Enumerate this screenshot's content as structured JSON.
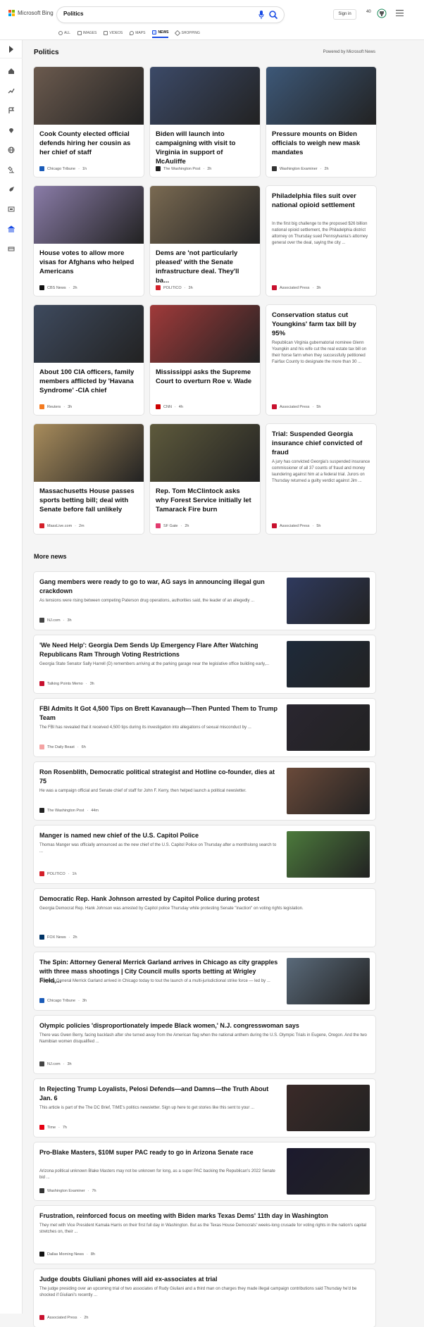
{
  "header": {
    "logo": "Microsoft Bing",
    "query": "Politics",
    "signin": "Sign in",
    "rewards": "40",
    "tabs": [
      {
        "label": "ALL",
        "icon": "search-icon"
      },
      {
        "label": "IMAGES",
        "icon": "image-icon"
      },
      {
        "label": "VIDEOS",
        "icon": "video-icon"
      },
      {
        "label": "MAPS",
        "icon": "map-pin-icon"
      },
      {
        "label": "NEWS",
        "icon": "news-icon",
        "active": true
      },
      {
        "label": "SHOPPING",
        "icon": "tag-icon"
      }
    ]
  },
  "section": {
    "title": "Politics",
    "powered": "Powered by Microsoft News"
  },
  "cards": [
    {
      "title": "Cook County elected official defends hiring her cousin as her chief of staff",
      "source": "Chicago Tribune",
      "time": "1h",
      "img": "#6b5a4e",
      "fav": "#1a5bb8"
    },
    {
      "title": "Biden will launch into campaigning with visit to Virginia in support of McAuliffe",
      "source": "The Washington Post",
      "time": "2h",
      "img": "#3c4a68",
      "fav": "#222"
    },
    {
      "title": "Pressure mounts on Biden officials to weigh new mask mandates",
      "source": "Washington Examiner",
      "time": "2h",
      "img": "#3d5878",
      "fav": "#333"
    },
    {
      "title": "House votes to allow more visas for Afghans who helped Americans",
      "source": "CBS News",
      "time": "2h",
      "img": "#8a7ca8",
      "fav": "#111"
    },
    {
      "title": "Dems are 'not particularly pleased' with the Senate infrastructure deal. They'll ba...",
      "source": "POLITICO",
      "time": "3h",
      "img": "#7a6a52",
      "fav": "#d4202a"
    },
    {
      "title": "Philadelphia files suit over national opioid settlement",
      "source": "Associated Press",
      "time": "3h",
      "snippet": "In the first big challenge to the proposed $26 billion national opioid settlement, the Philadelphia district attorney on Thursday sued Pennsylvania's attorney general over the deal, saying the city ...",
      "fav": "#c8102e"
    },
    {
      "title": "About 100 CIA officers, family members afflicted by 'Havana Syndrome' -CIA chief",
      "source": "Reuters",
      "time": "3h",
      "img": "#3e4a5e",
      "fav": "#f47b20"
    },
    {
      "title": "Mississippi asks the Supreme Court to overturn Roe v. Wade",
      "source": "CNN",
      "time": "4h",
      "img": "#a03a3a",
      "fav": "#cc0000"
    },
    {
      "title": "Conservation status cut Youngkins' farm tax bill by 95%",
      "source": "Associated Press",
      "time": "5h",
      "snippet": "Republican Virginia gubernatorial nominee Glenn Youngkin and his wife cut the real estate tax bill on their horse farm when they successfully petitioned Fairfax County to designate the more than 30 ...",
      "fav": "#c8102e"
    },
    {
      "title": "Massachusetts House passes sports betting bill; deal with Senate before fall unlikely",
      "source": "MassLive.com",
      "time": "2m",
      "img": "#a88c5c",
      "fav": "#d4202a"
    },
    {
      "title": "Rep. Tom McClintock asks why Forest Service initially let Tamarack Fire burn",
      "source": "SF Gate",
      "time": "2h",
      "img": "#5e5a3c",
      "fav": "#e23b6e"
    },
    {
      "title": "Trial: Suspended Georgia insurance chief convicted of fraud",
      "source": "Associated Press",
      "time": "5h",
      "snippet": "A jury has convicted Georgia's suspended insurance commissioner of all 37 counts of fraud and money laundering against him at a federal trial. Jurors on Thursday returned a guilty verdict against Jim ...",
      "fav": "#c8102e"
    }
  ],
  "more": {
    "title": "More news",
    "items": [
      {
        "title": "Gang members were ready to go to war, AG says in announcing illegal gun crackdown",
        "snippet": "As tensions were rising between competing Paterson drug operations, authorities said, the leader of an allegedly ...",
        "source": "NJ.com",
        "time": "3h",
        "img": "#2f3a5e",
        "fav": "#444"
      },
      {
        "title": "'We Need Help': Georgia Dem Sends Up Emergency Flare After Watching Republicans Ram Through Voting Restrictions",
        "snippet": "Georgia State Senator Sally Harrell (D) remembers arriving at the parking garage near the legislative office building early,...",
        "source": "Talking Points Memo",
        "time": "3h",
        "img": "#1e2a3a",
        "fav": "#c8102e"
      },
      {
        "title": "FBI Admits It Got 4,500 Tips on Brett Kavanaugh—Then Punted Them to Trump Team",
        "snippet": "The FBI has revealed that it received 4,500 tips during its investigation into allegations of sexual misconduct by ...",
        "source": "The Daily Beast",
        "time": "6h",
        "img": "#2a2630",
        "fav": "#f4a3a3"
      },
      {
        "title": "Ron Rosenblith, Democratic political strategist and Hotline co-founder, dies at 75",
        "snippet": "He was a campaign official and Senate chief of staff for John F. Kerry, then helped launch a political newsletter.",
        "source": "The Washington Post",
        "time": "44m",
        "img": "#6a4a3a",
        "fav": "#222"
      },
      {
        "title": "Manger is named new chief of the U.S. Capitol Police",
        "snippet": "Thomas Manger was officially announced as the new chief of the U.S. Capitol Police on Thursday after a monthslong search to ...",
        "source": "POLITICO",
        "time": "1h",
        "img": "#4c7a3c",
        "fav": "#d4202a"
      },
      {
        "title": "Democratic Rep. Hank Johnson arrested by Capitol Police during protest",
        "snippet": "Georgia Democrat Rep. Hank Johnson was arrested by Capitol police Thursday while protesting Senate \"inaction\" on voting rights legislation.",
        "source": "FOX News",
        "time": "2h",
        "fav": "#003366"
      },
      {
        "title": "The Spin: Attorney General Merrick Garland arrives in Chicago as city grapples with three mass shootings | City Council mulls sports betting at Wrigley Field,...",
        "snippet": "Attorney General Merrick Garland arrived in Chicago today to tout the launch of a multi-jurisdictional strike force — led by ...",
        "source": "Chicago Tribune",
        "time": "3h",
        "img": "#5a6a7a",
        "fav": "#1a5bb8"
      },
      {
        "title": "Olympic policies 'disproportionately impede Black women,' N.J. congresswoman says",
        "snippet": "There was Gwen Berry, facing backlash after she turned away from the American flag when the national anthem during the U.S. Olympic Trials in Eugene, Oregon. And the two Namibian women disqualified ...",
        "source": "NJ.com",
        "time": "3h",
        "fav": "#444"
      },
      {
        "title": "In Rejecting Trump Loyalists, Pelosi Defends—and Damns—the Truth About Jan. 6",
        "snippet": "This article is part of the The DC Brief, TIME's politics newsletter. Sign up here to get stories like this sent to your ...",
        "source": "Time",
        "time": "7h",
        "img": "#3a2a28",
        "fav": "#e60012"
      },
      {
        "title": "Pro-Blake Masters, $10M super PAC ready to go in Arizona Senate race",
        "snippet": "Arizona political unknown Blake Masters may not be unknown for long, as a super PAC backing the Republican's 2022 Senate bid ...",
        "source": "Washington Examiner",
        "time": "7h",
        "img": "#1c1a2e",
        "fav": "#333"
      },
      {
        "title": "Frustration, reinforced focus on meeting with Biden marks Texas Dems' 11th day in Washington",
        "snippet": "They met with Vice President Kamala Harris on their first full day in Washington. But as the Texas House Democrats' weeks-long crusade for voting rights in the nation's capital stretches on, their ...",
        "source": "Dallas Morning News",
        "time": "8h",
        "fav": "#111"
      },
      {
        "title": "Judge doubts Giuliani phones will aid ex-associates at trial",
        "snippet": "The judge presiding over an upcoming trial of two associates of Rudy Giuliani and a third man on charges they made illegal campaign contributions said Thursday he'd be shocked if Giuliani's recently ...",
        "source": "Associated Press",
        "time": "2h",
        "fav": "#c8102e"
      }
    ]
  }
}
